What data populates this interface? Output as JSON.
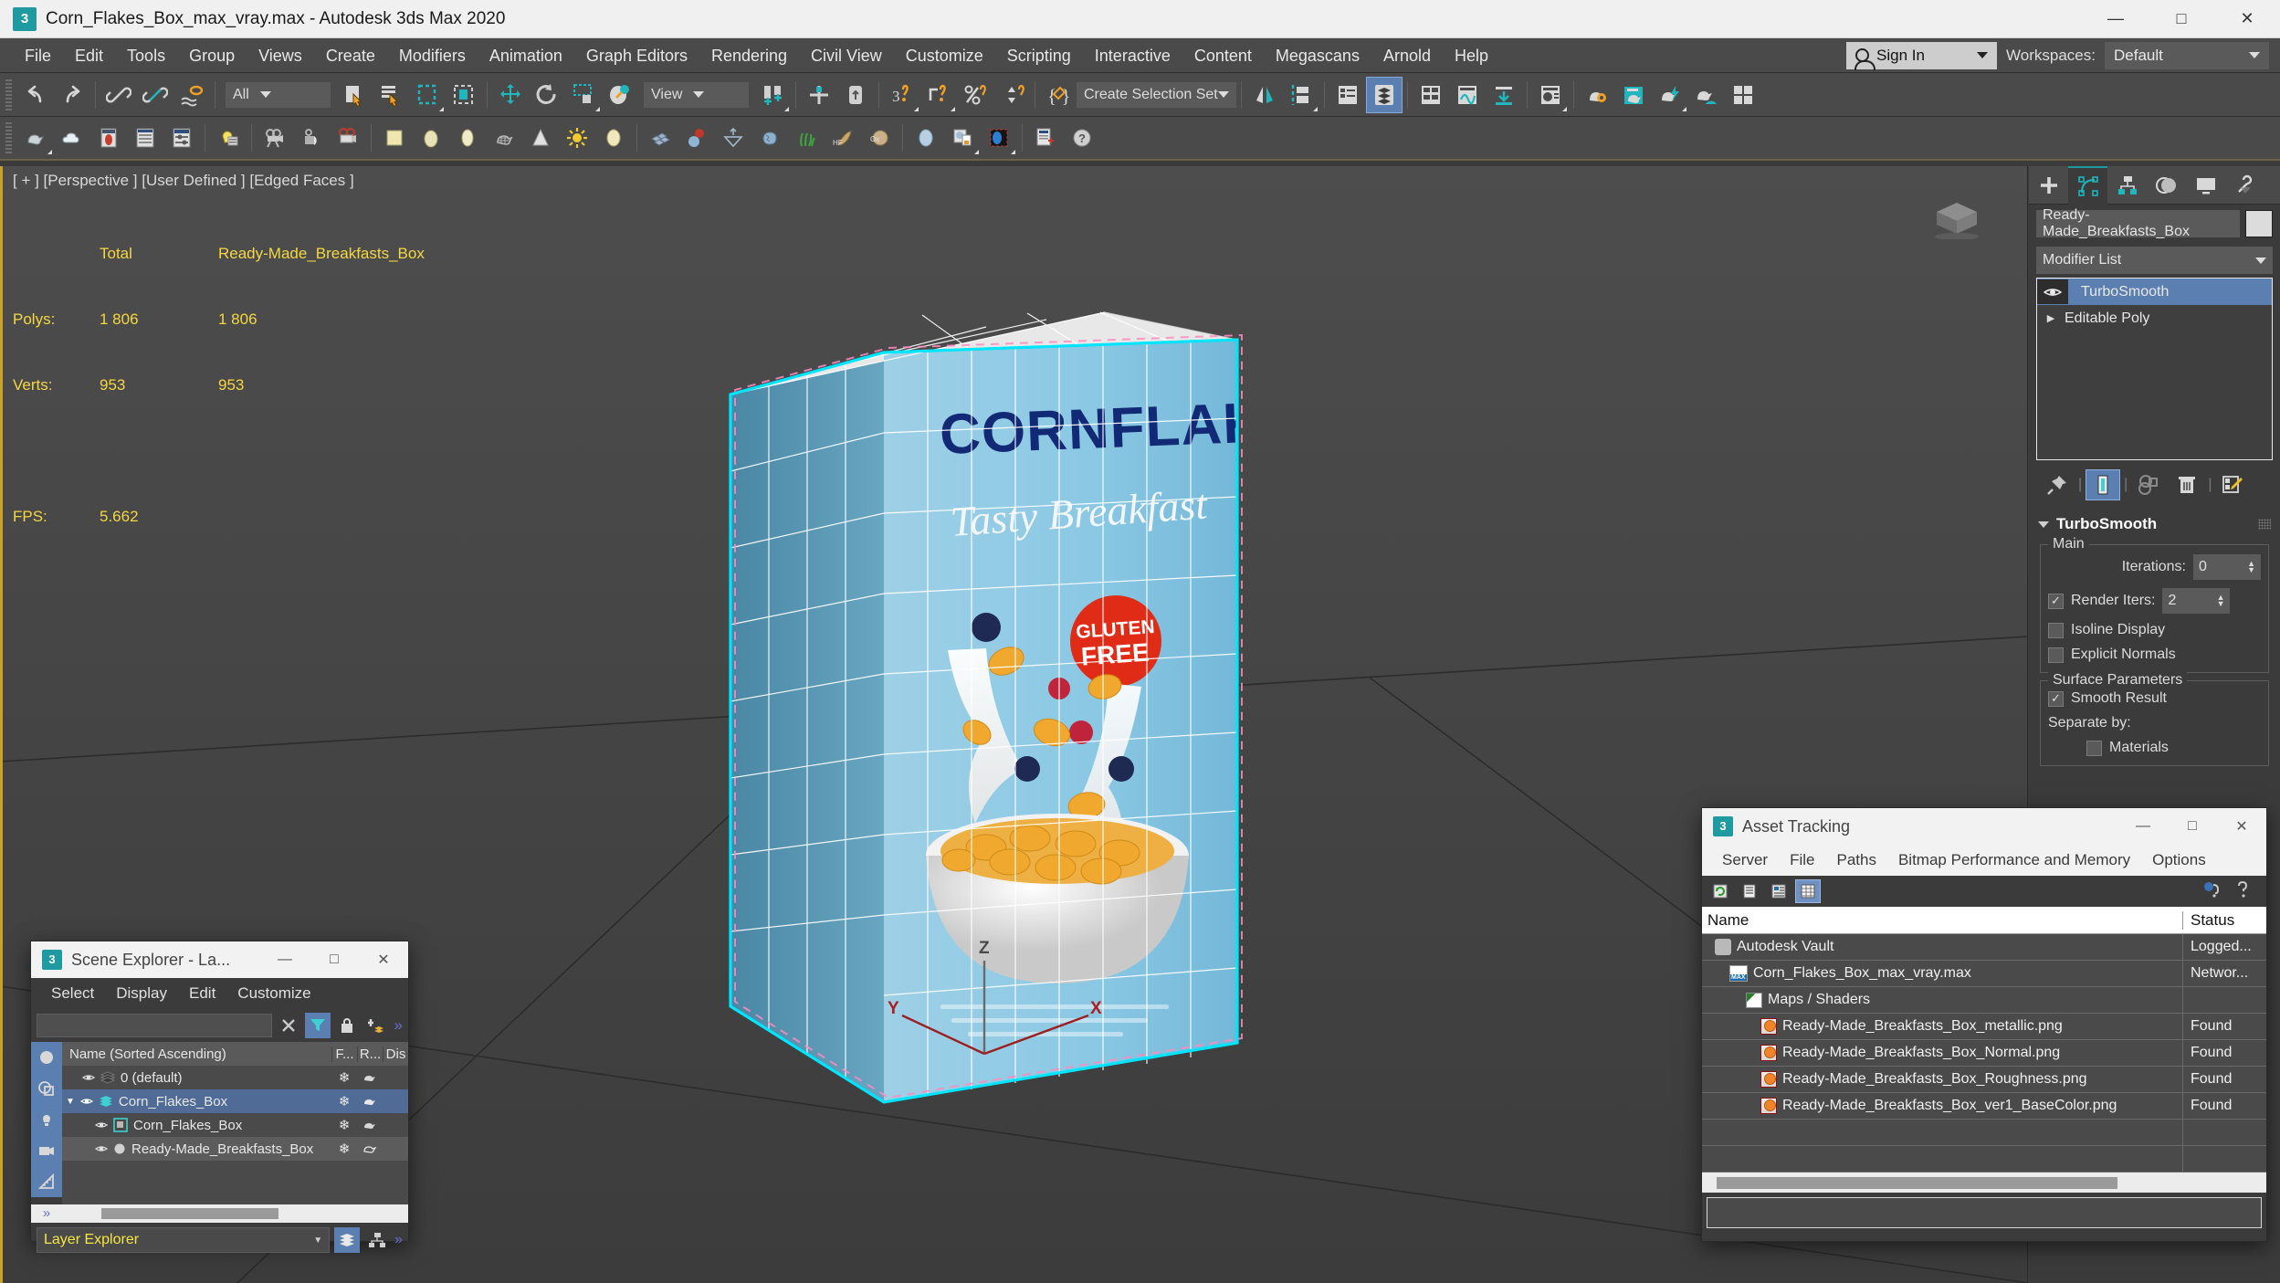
{
  "titlebar": {
    "title": "Corn_Flakes_Box_max_vray.max - Autodesk 3ds Max 2020",
    "app_icon": "3",
    "minimize": "—",
    "maximize": "□",
    "close": "✕"
  },
  "menubar": {
    "items": [
      "File",
      "Edit",
      "Tools",
      "Group",
      "Views",
      "Create",
      "Modifiers",
      "Animation",
      "Graph Editors",
      "Rendering",
      "Civil View",
      "Customize",
      "Scripting",
      "Interactive",
      "Content",
      "Megascans",
      "Arnold",
      "Help"
    ],
    "sign_in": "Sign In",
    "workspaces_label": "Workspaces:",
    "workspaces_value": "Default"
  },
  "toolbar": {
    "selection_filter": "All",
    "reference_coord": "View",
    "selection_set": "Create Selection Set"
  },
  "viewport": {
    "label": "[ + ] [Perspective ] [User Defined ] [Edged Faces ]",
    "stats": {
      "col_total": "Total",
      "col_object": "Ready-Made_Breakfasts_Box",
      "polys_label": "Polys:",
      "polys_total": "1 806",
      "polys_object": "1 806",
      "verts_label": "Verts:",
      "verts_total": "953",
      "verts_object": "953",
      "fps_label": "FPS:",
      "fps_value": "5.662"
    },
    "axis": {
      "x": "X",
      "y": "Y",
      "z": "Z"
    },
    "box_art": {
      "brand": "CORNFLAKES",
      "tagline": "Tasty Breakfast",
      "badge_line1": "GLUTEN",
      "badge_line2": "FREE"
    }
  },
  "command_panel": {
    "object_name": "Ready-Made_Breakfasts_Box",
    "modifier_list": "Modifier List",
    "stack": [
      {
        "label": "TurboSmooth",
        "selected": true
      },
      {
        "label": "Editable Poly",
        "selected": false
      }
    ],
    "rollout": {
      "title": "TurboSmooth",
      "main_group": "Main",
      "iterations_label": "Iterations:",
      "iterations_value": "0",
      "render_iters_label": "Render Iters:",
      "render_iters_value": "2",
      "render_iters_checked": true,
      "isoline_display": "Isoline Display",
      "isoline_checked": false,
      "explicit_normals": "Explicit Normals",
      "explicit_checked": false,
      "surface_group": "Surface Parameters",
      "smooth_result": "Smooth Result",
      "smooth_checked": true,
      "separate_by": "Separate by:",
      "materials": "Materials",
      "materials_checked": false
    }
  },
  "scene_explorer": {
    "title": "Scene Explorer - La...",
    "menu": [
      "Select",
      "Display",
      "Edit",
      "Customize"
    ],
    "search_value": "",
    "columns": [
      "Name (Sorted Ascending)",
      "F...",
      "R...",
      "Dis"
    ],
    "rows": [
      {
        "name": "0 (default)",
        "indent": 1,
        "icon": "layer-icon",
        "selected": false
      },
      {
        "name": "Corn_Flakes_Box",
        "indent": 0,
        "icon": "layer-icon-active",
        "selected": true
      },
      {
        "name": "Corn_Flakes_Box",
        "indent": 2,
        "icon": "object-icon",
        "selected": false
      },
      {
        "name": "Ready-Made_Breakfasts_Box",
        "indent": 2,
        "icon": "geometry-icon",
        "selected": true
      }
    ],
    "footer_combo": "Layer Explorer",
    "overflow": "»"
  },
  "asset_tracking": {
    "title": "Asset Tracking",
    "menu": [
      "Server",
      "File",
      "Paths",
      "Bitmap Performance and Memory",
      "Options"
    ],
    "columns": {
      "name": "Name",
      "status": "Status"
    },
    "rows": [
      {
        "name": "Autodesk Vault",
        "status": "Logged...",
        "indent": 1,
        "icon": "vault-icon"
      },
      {
        "name": "Corn_Flakes_Box_max_vray.max",
        "status": "Networ...",
        "indent": 2,
        "icon": "max-file-icon"
      },
      {
        "name": "Maps / Shaders",
        "status": "",
        "indent": 3,
        "icon": "folder-icon"
      },
      {
        "name": "Ready-Made_Breakfasts_Box_metallic.png",
        "status": "Found",
        "indent": 4,
        "icon": "png-icon"
      },
      {
        "name": "Ready-Made_Breakfasts_Box_Normal.png",
        "status": "Found",
        "indent": 4,
        "icon": "png-icon"
      },
      {
        "name": "Ready-Made_Breakfasts_Box_Roughness.png",
        "status": "Found",
        "indent": 4,
        "icon": "png-icon"
      },
      {
        "name": "Ready-Made_Breakfasts_Box_ver1_BaseColor.png",
        "status": "Found",
        "indent": 4,
        "icon": "png-icon"
      },
      {
        "name": "",
        "status": "",
        "indent": 0,
        "icon": ""
      },
      {
        "name": "",
        "status": "",
        "indent": 0,
        "icon": ""
      }
    ]
  },
  "colors": {
    "accent_teal": "#1f9aa0",
    "selection_blue": "#5a7fb0",
    "stats_yellow": "#f5d742",
    "box_blue": "#7fc2e0",
    "brand_navy": "#1a2f7a",
    "badge_red": "#e02b16",
    "gizmo_cyan": "#00e5ff",
    "gizmo_pink": "#ff8ac0"
  }
}
